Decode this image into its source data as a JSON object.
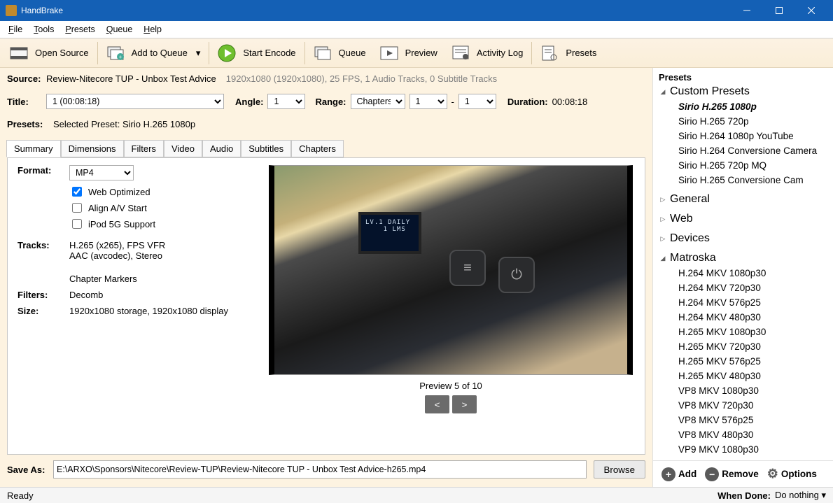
{
  "window": {
    "title": "HandBrake"
  },
  "menu": {
    "file": "File",
    "tools": "Tools",
    "presets": "Presets",
    "queue": "Queue",
    "help": "Help"
  },
  "toolbar": {
    "open_source": "Open Source",
    "add_to_queue": "Add to Queue",
    "start_encode": "Start Encode",
    "queue": "Queue",
    "preview": "Preview",
    "activity_log": "Activity Log",
    "presets": "Presets"
  },
  "source": {
    "label": "Source:",
    "name": "Review-Nitecore TUP - Unbox Test Advice",
    "details": "1920x1080 (1920x1080), 25 FPS, 1 Audio Tracks, 0 Subtitle Tracks"
  },
  "title_row": {
    "title_label": "Title:",
    "title_value": "1 (00:08:18)",
    "angle_label": "Angle:",
    "angle_value": "1",
    "range_label": "Range:",
    "range_type": "Chapters",
    "range_from": "1",
    "range_sep": "-",
    "range_to": "1",
    "duration_label": "Duration:",
    "duration_value": "00:08:18"
  },
  "preset_row": {
    "label": "Presets:",
    "text": "Selected Preset:  Sirio H.265 1080p"
  },
  "tabs": [
    "Summary",
    "Dimensions",
    "Filters",
    "Video",
    "Audio",
    "Subtitles",
    "Chapters"
  ],
  "summary": {
    "format_label": "Format:",
    "format_value": "MP4",
    "web_optimized": "Web Optimized",
    "align_av": "Align A/V Start",
    "ipod": "iPod 5G Support",
    "tracks_label": "Tracks:",
    "tracks1": "H.265 (x265),  FPS VFR",
    "tracks2": "AAC (avcodec), Stereo",
    "tracks3": "Chapter Markers",
    "filters_label": "Filters:",
    "filters_value": "Decomb",
    "size_label": "Size:",
    "size_value": "1920x1080 storage, 1920x1080 display",
    "preview_label": "Preview 5 of 10",
    "prev_btn": "<",
    "next_btn": ">"
  },
  "save_as": {
    "label": "Save As:",
    "value": "E:\\ARXO\\Sponsors\\Nitecore\\Review-TUP\\Review-Nitecore TUP - Unbox Test Advice-h265.mp4",
    "browse": "Browse"
  },
  "right": {
    "title": "Presets",
    "groups": {
      "custom": "Custom Presets",
      "general": "General",
      "web": "Web",
      "devices": "Devices",
      "matroska": "Matroska"
    },
    "custom_items": [
      "Sirio H.265 1080p",
      "Sirio H.265 720p",
      "Sirio H.264 1080p YouTube",
      "Sirio H.264 Conversione Camera",
      "Sirio H.265 720p MQ",
      "Sirio H.265 Conversione Cam"
    ],
    "matroska_items": [
      "H.264 MKV 1080p30",
      "H.264 MKV 720p30",
      "H.264 MKV 576p25",
      "H.264 MKV 480p30",
      "H.265 MKV 1080p30",
      "H.265 MKV 720p30",
      "H.265 MKV 576p25",
      "H.265 MKV 480p30",
      "VP8 MKV 1080p30",
      "VP8 MKV 720p30",
      "VP8 MKV 576p25",
      "VP8 MKV 480p30",
      "VP9 MKV 1080p30"
    ],
    "add": "Add",
    "remove": "Remove",
    "options": "Options"
  },
  "status": {
    "ready": "Ready",
    "when_done_lbl": "When Done:",
    "when_done_val": "Do nothing"
  }
}
